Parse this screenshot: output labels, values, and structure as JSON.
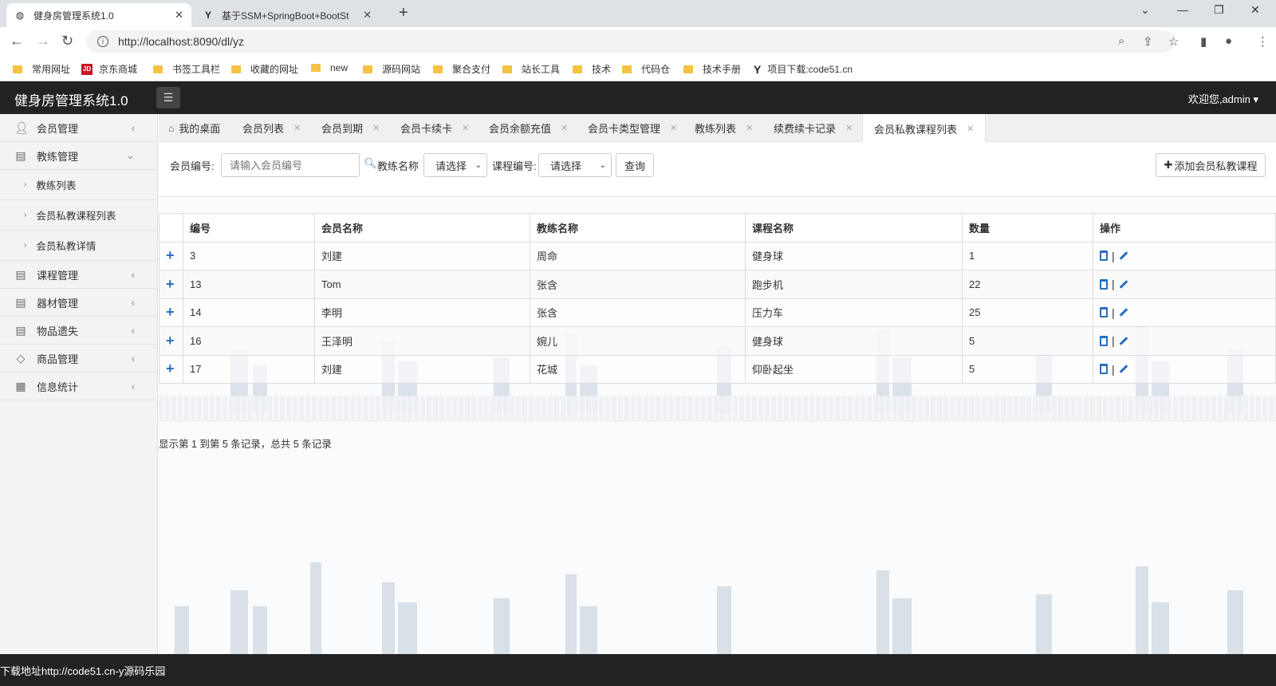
{
  "browser": {
    "tabs": [
      {
        "title": "健身房管理系统1.0",
        "active": true
      },
      {
        "title": "基于SSM+SpringBoot+BootSt",
        "active": false
      }
    ],
    "url": "http://localhost:8090/dl/yz",
    "bookmarks": [
      "常用网址",
      "京东商城",
      "书签工具栏",
      "收藏的网址",
      "new",
      "源码网站",
      "聚合支付",
      "站长工具",
      "技术",
      "代码仓",
      "技术手册",
      "项目下载:code51.cn"
    ]
  },
  "header": {
    "title": "健身房管理系统1.0",
    "welcome": "欢迎您,admin"
  },
  "sidebar": {
    "items": [
      {
        "label": "会员管理",
        "icon": "user-icon"
      },
      {
        "label": "教练管理",
        "icon": "clipboard-icon",
        "expanded": true,
        "children": [
          "教练列表",
          "会员私教课程列表",
          "会员私教详情"
        ]
      },
      {
        "label": "课程管理",
        "icon": "clipboard-icon"
      },
      {
        "label": "器材管理",
        "icon": "clipboard-icon"
      },
      {
        "label": "物品遗失",
        "icon": "clipboard-icon"
      },
      {
        "label": "商品管理",
        "icon": "shopping-icon"
      },
      {
        "label": "信息统计",
        "icon": "grid-icon"
      }
    ]
  },
  "page_tabs": [
    "我的桌面",
    "会员列表",
    "会员到期",
    "会员卡续卡",
    "会员余额充值",
    "会员卡类型管理",
    "教练列表",
    "续费续卡记录",
    "会员私教课程列表"
  ],
  "search": {
    "member_no_label": "会员编号:",
    "member_no_placeholder": "请输入会员编号",
    "coach_label": "教练名称",
    "coach_select": "请选择",
    "course_label": "课程编号:",
    "course_select": "请选择",
    "query_button": "查询",
    "add_button": "添加会员私教课程"
  },
  "table": {
    "columns": [
      "编号",
      "会员名称",
      "教练名称",
      "课程名称",
      "数量",
      "操作"
    ],
    "rows": [
      {
        "id": "3",
        "member": "刘建",
        "coach": "周命",
        "course": "健身球",
        "qty": "1"
      },
      {
        "id": "13",
        "member": "Tom",
        "coach": "张含",
        "course": "跑步机",
        "qty": "22"
      },
      {
        "id": "14",
        "member": "李明",
        "coach": "张含",
        "course": "压力车",
        "qty": "25"
      },
      {
        "id": "16",
        "member": "王泽明",
        "coach": "婉儿",
        "course": "健身球",
        "qty": "5"
      },
      {
        "id": "17",
        "member": "刘建",
        "coach": "花城",
        "course": "仰卧起坐",
        "qty": "5"
      }
    ]
  },
  "pagination": {
    "info": "显示第 1 到第 5 条记录，总共 5 条记录"
  },
  "footer": {
    "text": "下载地址http://code51.cn-y源码乐园"
  }
}
